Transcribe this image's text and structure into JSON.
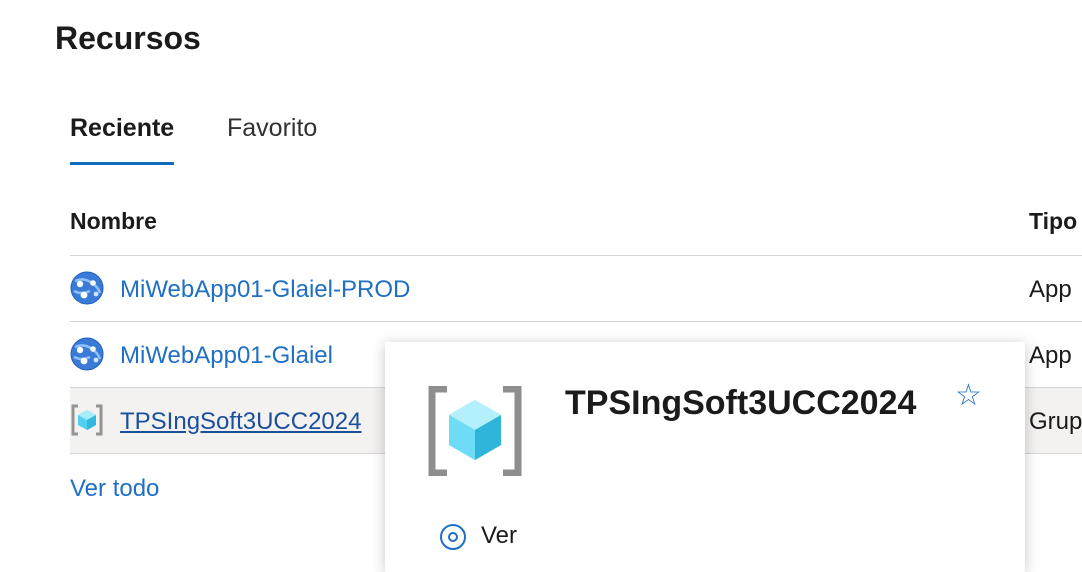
{
  "page": {
    "title": "Recursos"
  },
  "tabs": [
    {
      "label": "Reciente",
      "active": true
    },
    {
      "label": "Favorito",
      "active": false
    }
  ],
  "table": {
    "columns": [
      "Nombre",
      "Tipo"
    ],
    "rows": [
      {
        "name": "MiWebApp01-Glaiel-PROD",
        "type": "App",
        "icon": "web-app-icon"
      },
      {
        "name": "MiWebApp01-Glaiel",
        "type": "App",
        "icon": "web-app-icon"
      },
      {
        "name": "TPSIngSoft3UCC2024",
        "type": "Grup",
        "icon": "resource-group-icon"
      }
    ]
  },
  "links": {
    "view_all": "Ver todo"
  },
  "hover_card": {
    "name": "TPSIngSoft3UCC2024",
    "icon": "resource-group-icon",
    "favorite_icon": "star-outline-icon",
    "action_label": "Ver",
    "action_icon": "view-icon"
  },
  "colors": {
    "accent": "#0f6cbd",
    "link": "#1f6fc5",
    "selected_row": "#f3f2f1"
  }
}
